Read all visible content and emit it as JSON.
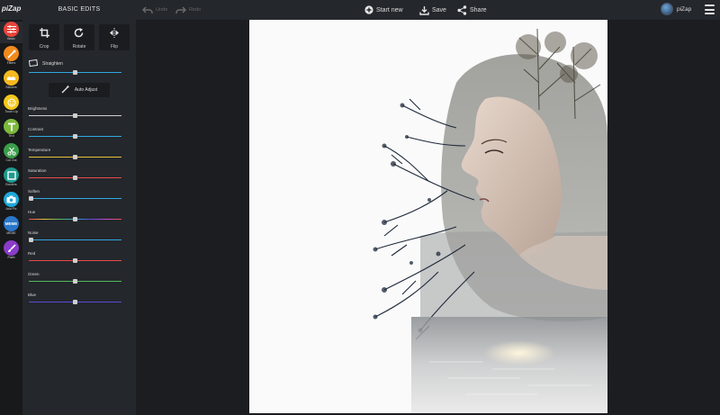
{
  "app": {
    "logo": "piZap",
    "panel_title": "BASIC EDITS"
  },
  "toolbar": {
    "undo": "Undo",
    "redo": "Redo",
    "start_new": "Start new",
    "save": "Save",
    "share": "Share"
  },
  "user": {
    "name": "piZap"
  },
  "rail": {
    "items": [
      {
        "label": "Basic",
        "color": "#e8453c",
        "icon": "sliders-icon"
      },
      {
        "label": "Filters",
        "color": "#f08a1c",
        "icon": "wand-icon"
      },
      {
        "label": "Stickers",
        "color": "#f5b81e",
        "icon": "sticker-icon"
      },
      {
        "label": "Touch Up",
        "color": "#f2c81c",
        "icon": "face-icon"
      },
      {
        "label": "Text",
        "color": "#7cb93c",
        "icon": "text-icon"
      },
      {
        "label": "Cut Out",
        "color": "#3a9e4a",
        "icon": "scissors-icon"
      },
      {
        "label": "Borders",
        "color": "#1e9a8e",
        "icon": "border-icon"
      },
      {
        "label": "Add Pic",
        "color": "#1ea8d8",
        "icon": "camera-icon"
      },
      {
        "label": "MEME",
        "color": "#2a76c8",
        "icon": "meme-icon"
      },
      {
        "label": "Paint",
        "color": "#8a3cc8",
        "icon": "brush-icon"
      }
    ]
  },
  "tools": {
    "crop": "Crop",
    "rotate": "Rotate",
    "flip": "Flip"
  },
  "straighten": {
    "label": "Straighten",
    "value": 0.5
  },
  "auto_adjust": "Auto Adjust",
  "sliders": [
    {
      "label": "Brightness",
      "value": 0.5,
      "color": "#cfcfcf"
    },
    {
      "label": "Contrast",
      "value": 0.5,
      "color": "#2fa8e0"
    },
    {
      "label": "Temperature",
      "value": 0.5,
      "color": "#e8c03a"
    },
    {
      "label": "Saturation",
      "value": 0.5,
      "color": "#e84a4a"
    },
    {
      "label": "Soften",
      "value": 0.02,
      "color": "#2fa8e0"
    },
    {
      "label": "Hue",
      "value": 0.5,
      "color": "rainbow"
    },
    {
      "label": "Noise",
      "value": 0.02,
      "color": "#2fa8e0"
    },
    {
      "label": "Red",
      "value": 0.5,
      "color": "#e84a4a"
    },
    {
      "label": "Green",
      "value": 0.5,
      "color": "#55b85a"
    },
    {
      "label": "Blue",
      "value": 0.5,
      "color": "#5a4ad8"
    }
  ]
}
